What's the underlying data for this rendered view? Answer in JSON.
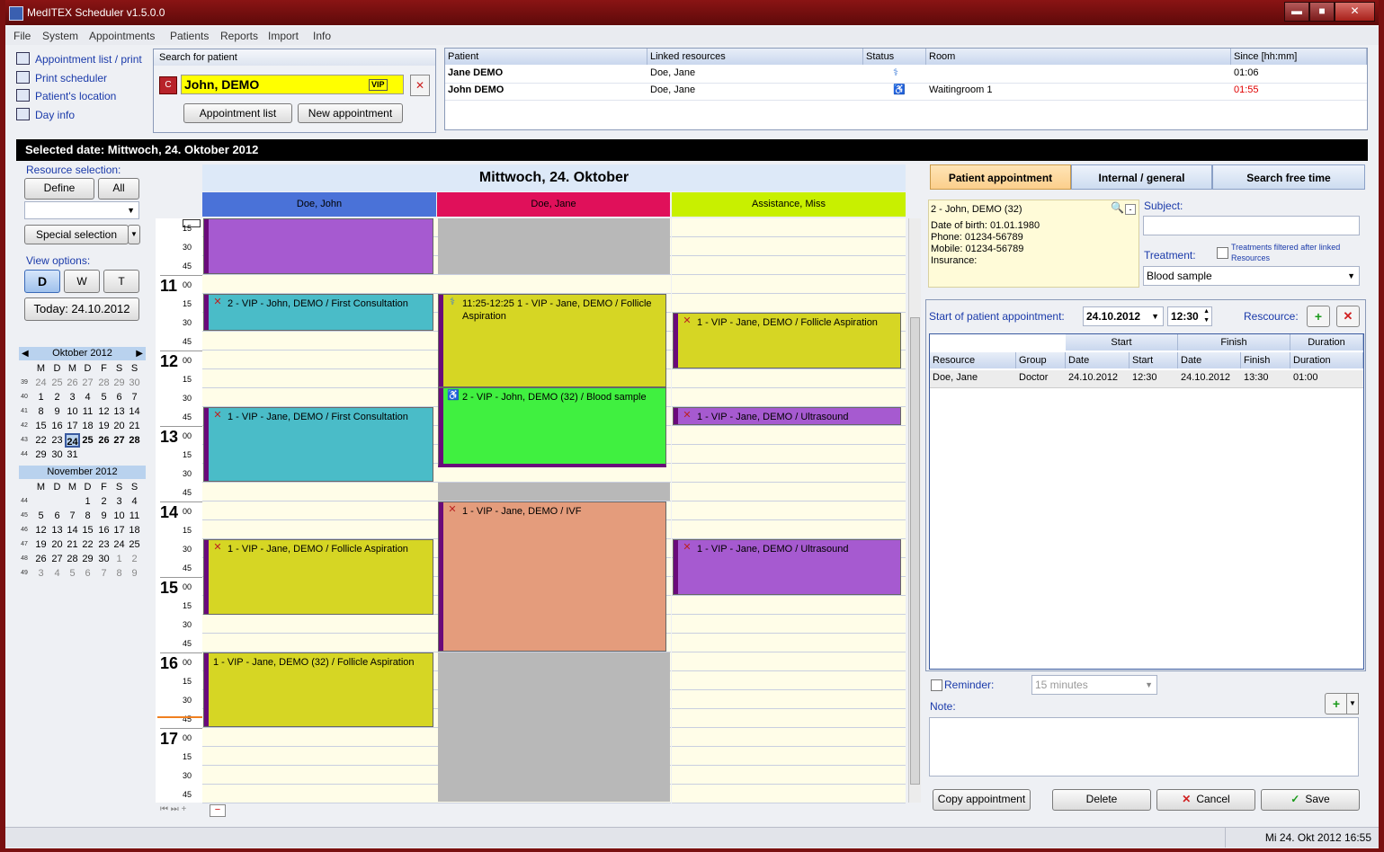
{
  "app": {
    "title": "MedITEX  Scheduler v1.5.0.0",
    "btn_min": "▬",
    "btn_max": "■",
    "btn_close": "✕"
  },
  "menu": [
    "File",
    "System",
    "Appointments",
    "Patients",
    "Reports",
    "Import",
    "Info"
  ],
  "quick_links": [
    "Appointment list / print",
    "Print scheduler",
    "Patient's location",
    "Day info"
  ],
  "search": {
    "title": "Search for patient",
    "patient_name": "John, DEMO",
    "vip_badge": "VIP",
    "appointment_list_label": "Appointment list",
    "new_appointment_label": "New appointment"
  },
  "patients_table": {
    "headers": [
      "Patient",
      "Linked resources",
      "Status",
      "Room",
      "Since [hh:mm]"
    ],
    "rows": [
      {
        "patient": "Jane DEMO",
        "linked": "Doe, Jane",
        "room": "",
        "since": "01:06"
      },
      {
        "patient": "John DEMO",
        "linked": "Doe, Jane",
        "room": "Waitingroom 1",
        "since": "01:55"
      }
    ]
  },
  "selected_date": "Selected date: Mittwoch, 24. Oktober 2012",
  "left": {
    "resource_selection": "Resource selection:",
    "define_label": "Define",
    "all_label": "All",
    "special_selection_label": "Special selection",
    "view_options": "View options:",
    "view_d": "D",
    "view_w": "W",
    "view_t": "T",
    "today_label": "Today: 24.10.2012"
  },
  "calendar": {
    "oct_title": "Oktober 2012",
    "nov_title": "November 2012",
    "weekdays": [
      "M",
      "D",
      "M",
      "D",
      "F",
      "S",
      "S"
    ],
    "oct_weeks": [
      "39",
      "40",
      "41",
      "42",
      "43",
      "44"
    ],
    "oct_days": [
      [
        "24",
        "25",
        "26",
        "27",
        "28",
        "29",
        "30"
      ],
      [
        "1",
        "2",
        "3",
        "4",
        "5",
        "6",
        "7"
      ],
      [
        "8",
        "9",
        "10",
        "11",
        "12",
        "13",
        "14"
      ],
      [
        "15",
        "16",
        "17",
        "18",
        "19",
        "20",
        "21"
      ],
      [
        "22",
        "23",
        "24",
        "25",
        "26",
        "27",
        "28"
      ],
      [
        "29",
        "30",
        "31",
        "",
        "",
        "",
        ""
      ]
    ],
    "nov_weeks": [
      "44",
      "45",
      "46",
      "47",
      "48",
      "49"
    ],
    "nov_days": [
      [
        "",
        "",
        "",
        "1",
        "2",
        "3",
        "4"
      ],
      [
        "5",
        "6",
        "7",
        "8",
        "9",
        "10",
        "11"
      ],
      [
        "12",
        "13",
        "14",
        "15",
        "16",
        "17",
        "18"
      ],
      [
        "19",
        "20",
        "21",
        "22",
        "23",
        "24",
        "25"
      ],
      [
        "26",
        "27",
        "28",
        "29",
        "30",
        "1",
        "2"
      ],
      [
        "3",
        "4",
        "5",
        "6",
        "7",
        "8",
        "9"
      ]
    ]
  },
  "schedule": {
    "day_title": "Mittwoch, 24. Oktober",
    "resources": [
      {
        "name": "Doe, John",
        "color": "#4a72d8"
      },
      {
        "name": "Doe, Jane",
        "color": "#e0105a"
      },
      {
        "name": "Assistance, Miss",
        "color": "#c8f000"
      }
    ],
    "hours": [
      "11",
      "12",
      "13",
      "14",
      "15",
      "16",
      "17"
    ],
    "mins": [
      "00",
      "15",
      "30",
      "45"
    ],
    "top_mins": [
      "15",
      "30",
      "45"
    ],
    "appointments": {
      "a1": "2 - VIP - John, DEMO / First Consultation",
      "a2": "1 - VIP - Jane, DEMO / First Consultation",
      "a3": "1 - VIP - Jane, DEMO / Follicle Aspiration",
      "a4": "1 - VIP - Jane, DEMO (32) / Follicle Aspiration",
      "b1": "11:25-12:25 1 - VIP - Jane, DEMO / Follicle Aspiration",
      "b2": "2 - VIP - John, DEMO (32) / Blood sample",
      "b3": "1 - VIP - Jane, DEMO / IVF",
      "c1": "1 - VIP - Jane, DEMO / Follicle Aspiration",
      "c2": "1 - VIP - Jane, DEMO / Ultrasound",
      "c3": "1 - VIP - Jane, DEMO / Ultrasound"
    }
  },
  "right": {
    "tabs": [
      "Patient appointment",
      "Internal / general",
      "Search free time"
    ],
    "patient_info": {
      "name": "2 - John, DEMO (32)",
      "dob": "Date of birth: 01.01.1980",
      "phone": "Phone: 01234-56789",
      "mobile": "Mobile: 01234-56789",
      "insurance": "Insurance:"
    },
    "subject_label": "Subject:",
    "treatment_label": "Treatment:",
    "treatment_value": "Blood sample",
    "filter_label": "Treatments  filtered after linked Resources",
    "start_label": "Start of patient appointment:",
    "start_date": "24.10.2012",
    "start_time": "12:30",
    "resource_label": "Rescource:",
    "res_table": {
      "group_headers": [
        "Start",
        "Finish",
        "Duration"
      ],
      "headers": [
        "Resource",
        "Group",
        "Date",
        "Start",
        "Date",
        "Finish",
        "Duration"
      ],
      "row": [
        "Doe, Jane",
        "Doctor",
        "24.10.2012",
        "12:30",
        "24.10.2012",
        "13:30",
        "01:00"
      ]
    },
    "reminder_label": "Reminder:",
    "reminder_value": "15 minutes",
    "note_label": "Note:",
    "copy_label": "Copy appointment",
    "delete_label": "Delete",
    "cancel_label": "Cancel",
    "save_label": "Save"
  },
  "status_bar": "Mi 24. Okt 2012 16:55"
}
